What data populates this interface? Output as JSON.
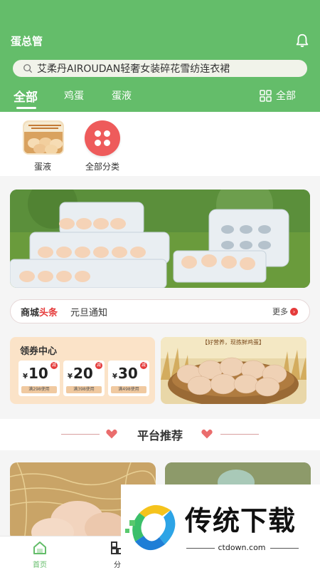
{
  "header": {
    "title": "蛋总管",
    "search_placeholder": "艾柔丹AIROUDAN轻奢女装碎花雪纺连衣裙",
    "tabs": [
      "全部",
      "鸡蛋",
      "蛋液"
    ],
    "all_label": "全部"
  },
  "categories": [
    {
      "label": "蛋液",
      "icon": "egg-tray-thumb"
    },
    {
      "label": "全部分类",
      "icon": "grid-dots-icon"
    }
  ],
  "news": {
    "brand_prefix": "商城",
    "brand_suffix": "头条",
    "text": "元旦通知",
    "more": "更多"
  },
  "coupon_center": {
    "title": "领券中心",
    "currency": "¥",
    "tag": "减",
    "coupons": [
      {
        "amount": "10",
        "condition": "满298使用"
      },
      {
        "amount": "20",
        "condition": "满398使用"
      },
      {
        "amount": "30",
        "condition": "满498使用"
      }
    ]
  },
  "egg_banner_text": "【好营养，现拣鲜鸡蛋】",
  "recommend": {
    "title": "平台推荐"
  },
  "tabbar": [
    {
      "label": "首页",
      "icon": "home-icon"
    },
    {
      "label": "分",
      "icon": "category-icon"
    }
  ],
  "watermark": {
    "text": "传统下载",
    "url": "ctdown.com"
  },
  "colors": {
    "primary": "#64bd6a",
    "accent": "#e53b3b",
    "coupon_bg": "#fbe3c8"
  }
}
